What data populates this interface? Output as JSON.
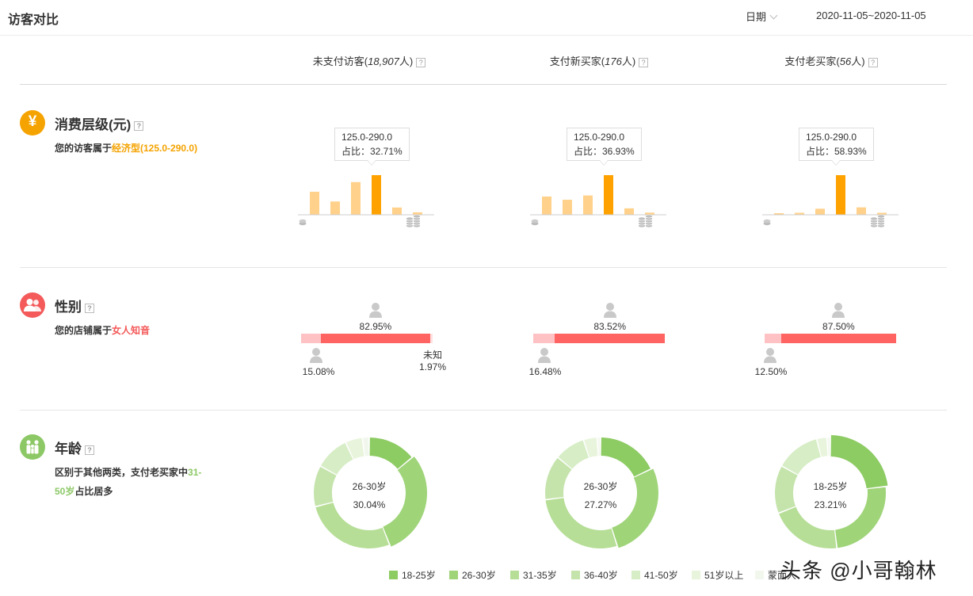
{
  "header": {
    "title": "访客对比",
    "period_label": "日期",
    "date_range": "2020-11-05~2020-11-05"
  },
  "columns": [
    {
      "label_prefix": "未支付访客(",
      "count": "18,907",
      "label_suffix": "人)"
    },
    {
      "label_prefix": "支付新买家(",
      "count": "176",
      "label_suffix": "人)"
    },
    {
      "label_prefix": "支付老买家(",
      "count": "56",
      "label_suffix": "人)"
    }
  ],
  "help_glyph": "?",
  "consumption": {
    "title": "消费层级(元)",
    "icon": "yen-icon",
    "icon_glyph": "¥",
    "desc_prefix": "您的访客属于",
    "desc_highlight": "经济型(125.0-290.0)",
    "highlight_color": "#f5a300",
    "bar_color": "#ffd18a",
    "bar_highlight_color": "#ffa200"
  },
  "gender": {
    "title": "性别",
    "icon": "users-icon",
    "desc_prefix": "您的店铺属于",
    "desc_highlight": "女人知音",
    "highlight_color": "#f45a5a",
    "female_color": "#ff6462",
    "male_color": "#ffc2c4"
  },
  "age": {
    "title": "年龄",
    "icon": "family-icon",
    "desc_prefix": "区别于其他两类，支付老买家中",
    "desc_highlight_1": "31-",
    "desc_highlight_2": "50岁",
    "desc_suffix": "占比居多",
    "highlight_color": "#8cc866",
    "legend": [
      {
        "label": "18-25岁",
        "color": "#8dcb63"
      },
      {
        "label": "26-30岁",
        "color": "#9fd479"
      },
      {
        "label": "31-35岁",
        "color": "#b6de97"
      },
      {
        "label": "36-40岁",
        "color": "#c5e4ac"
      },
      {
        "label": "41-50岁",
        "color": "#d6edc5"
      },
      {
        "label": "51岁以上",
        "color": "#e8f4dc"
      },
      {
        "label": "蒙面人",
        "color": "#f2f7ee"
      }
    ]
  },
  "chart_data": [
    {
      "type": "bar",
      "title": "",
      "series": [
        {
          "values": [
            0.19,
            0.11,
            0.27,
            0.3271,
            0.06,
            0.02
          ]
        }
      ],
      "highlight_index": 3,
      "tooltip_range": "125.0-290.0",
      "tooltip_share": "占比：32.71%"
    },
    {
      "type": "bar",
      "title": "",
      "series": [
        {
          "values": [
            0.17,
            0.14,
            0.18,
            0.3693,
            0.06,
            0.02
          ]
        }
      ],
      "highlight_index": 3,
      "tooltip_range": "125.0-290.0",
      "tooltip_share": "占比：36.93%"
    },
    {
      "type": "bar",
      "title": "",
      "series": [
        {
          "values": [
            0.02,
            0.03,
            0.09,
            0.5893,
            0.11,
            0.03
          ]
        }
      ],
      "highlight_index": 3,
      "tooltip_range": "125.0-290.0",
      "tooltip_share": "占比：58.93%"
    },
    {
      "type": "bar",
      "title": "",
      "categories": [
        "女",
        "男",
        "未知"
      ],
      "values": [
        82.95,
        15.08,
        1.97
      ],
      "labels": {
        "female": "82.95%",
        "male": "15.08%",
        "unknown_name": "未知",
        "unknown": "1.97%"
      }
    },
    {
      "type": "bar",
      "title": "",
      "categories": [
        "女",
        "男"
      ],
      "values": [
        83.52,
        16.48
      ],
      "labels": {
        "female": "83.52%",
        "male": "16.48%"
      }
    },
    {
      "type": "bar",
      "title": "",
      "categories": [
        "女",
        "男"
      ],
      "values": [
        87.5,
        12.5
      ],
      "labels": {
        "female": "87.50%",
        "male": "12.50%"
      }
    },
    {
      "type": "pie",
      "title": "",
      "categories": [
        "18-25岁",
        "26-30岁",
        "31-35岁",
        "36-40岁",
        "41-50岁",
        "51岁以上",
        "蒙面人"
      ],
      "values": [
        14,
        30.04,
        27,
        12,
        10,
        5,
        2
      ],
      "center_label": "26-30岁",
      "center_value": "30.04%"
    },
    {
      "type": "pie",
      "title": "",
      "categories": [
        "18-25岁",
        "26-30岁",
        "31-35岁",
        "36-40岁",
        "41-50岁",
        "51岁以上",
        "蒙面人"
      ],
      "values": [
        18,
        27.27,
        28,
        13,
        9,
        4,
        1
      ],
      "center_label": "26-30岁",
      "center_value": "27.27%"
    },
    {
      "type": "pie",
      "title": "",
      "categories": [
        "18-25岁",
        "26-30岁",
        "31-35岁",
        "36-40岁",
        "41-50岁",
        "51岁以上",
        "蒙面人"
      ],
      "values": [
        23.21,
        25,
        21,
        14,
        13,
        3,
        1
      ],
      "center_label": "18-25岁",
      "center_value": "23.21%"
    }
  ],
  "watermark": "头条 @小哥翰林"
}
